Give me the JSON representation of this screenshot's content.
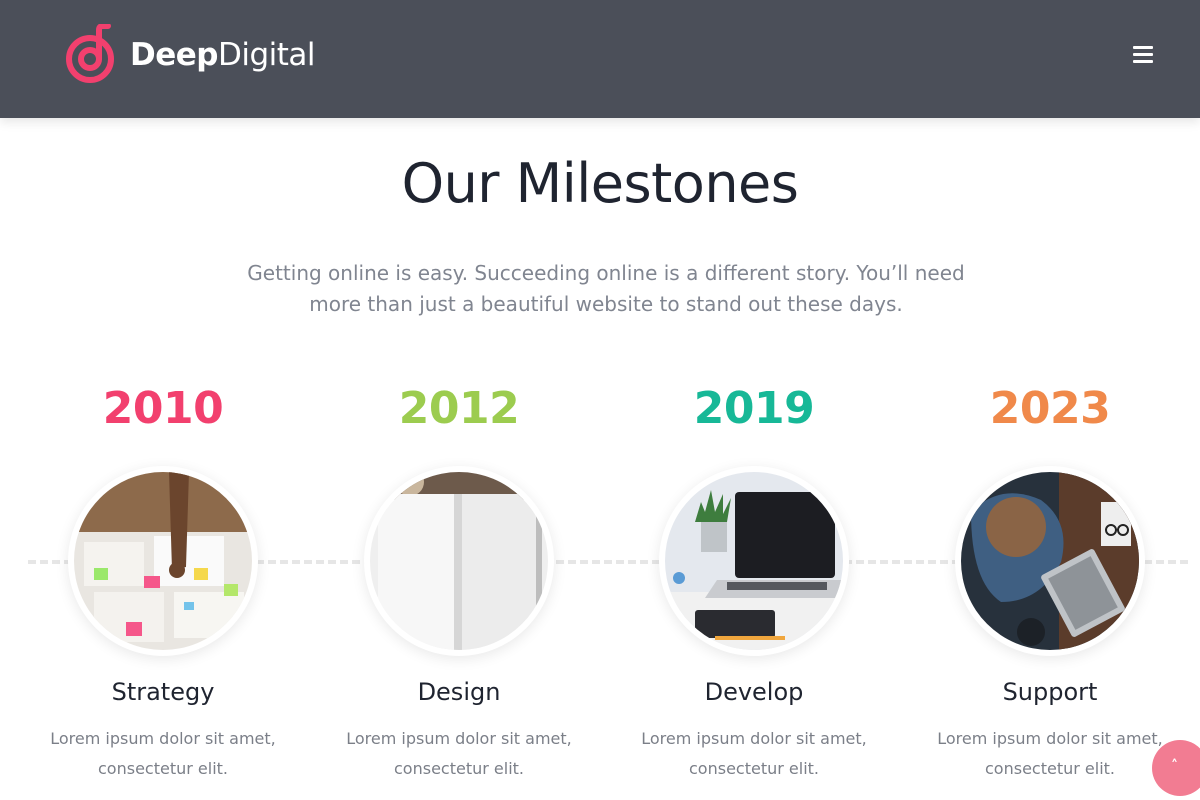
{
  "header": {
    "brand_bold": "Deep",
    "brand_light": "Digital",
    "menu_icon": "hamburger-menu-icon",
    "bg_color": "#4b4f59",
    "accent_color": "#f2406e"
  },
  "section": {
    "title": "Our Milestones",
    "subtitle": "Getting online is easy. Succeeding online is a different story. You’ll need more than just a beautiful website to stand out these days."
  },
  "milestones": [
    {
      "year": "2010",
      "title": "Strategy",
      "desc": "Lorem ipsum dolor sit amet, consectetur elit.",
      "year_color": "#f2406e",
      "image": "strategy-meeting-photo"
    },
    {
      "year": "2012",
      "title": "Design",
      "desc": "Lorem ipsum dolor sit amet, consectetur elit.",
      "year_color": "#9ccc4f",
      "image": "open-book-photo"
    },
    {
      "year": "2019",
      "title": "Develop",
      "desc": "Lorem ipsum dolor sit amet, consectetur elit.",
      "year_color": "#17b897",
      "image": "laptop-desk-photo"
    },
    {
      "year": "2023",
      "title": "Support",
      "desc": "Lorem ipsum dolor sit amet, consectetur elit.",
      "year_color": "#f0894a",
      "image": "person-typing-laptop-photo"
    }
  ],
  "scroll_top": {
    "icon": "chevron-up-icon",
    "glyph": "˄",
    "color": "#f27c92"
  }
}
